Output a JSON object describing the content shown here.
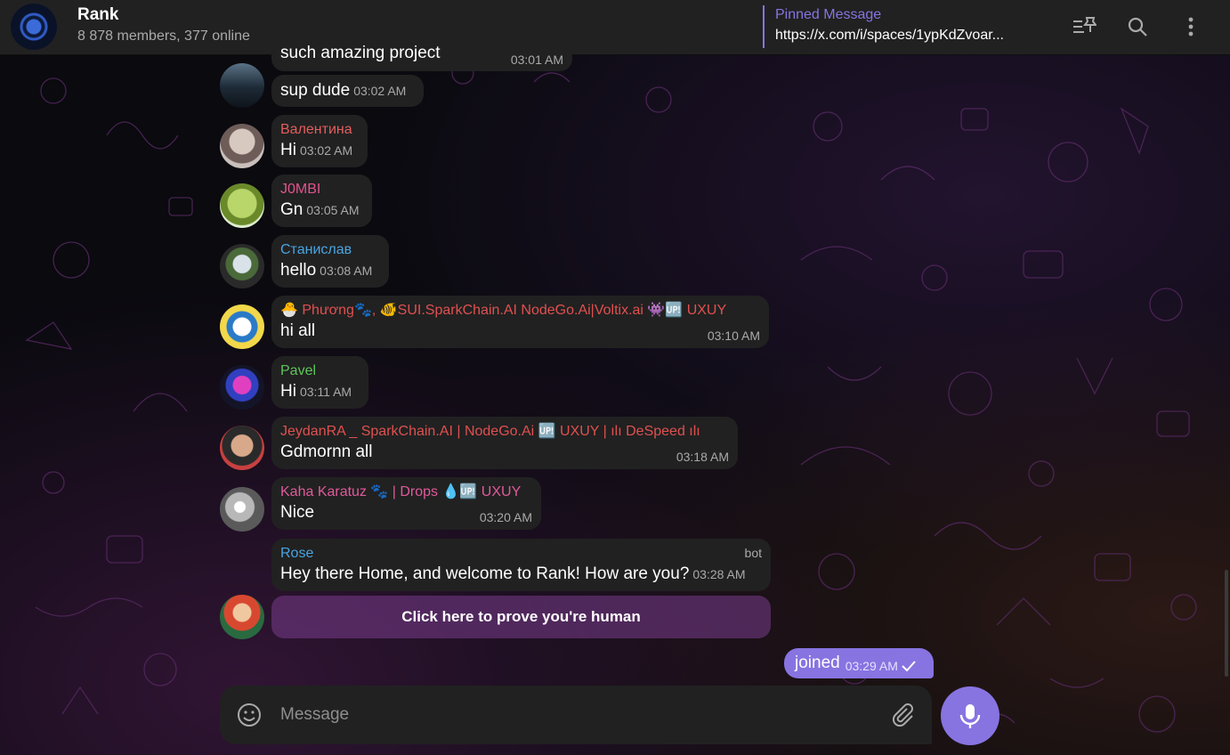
{
  "header": {
    "title": "Rank",
    "subtitle": "8 878 members, 377 online",
    "pinned_label": "Pinned Message",
    "pinned_text": "https://x.com/i/spaces/1ypKdZvoar..."
  },
  "messages": [
    {
      "sender": "",
      "text": "such amazing project",
      "time": "03:01 AM"
    },
    {
      "sender": "",
      "text": "sup dude",
      "time": "03:02 AM"
    },
    {
      "sender": "Валентина",
      "text": "Hi",
      "time": "03:02 AM",
      "color": "#e45d5d"
    },
    {
      "sender": "J0MBI",
      "text": "Gn",
      "time": "03:05 AM",
      "color": "#e0548c"
    },
    {
      "sender": "Станислав",
      "text": "hello",
      "time": "03:08 AM",
      "color": "#4aa4e0"
    },
    {
      "sender": "🐣 Phương🐾, 🐠SUI.SparkChain.AI NodeGo.Ai|Voltix.ai 👾🆙 UXUY",
      "text": "hi all",
      "time": "03:10 AM",
      "color": "#e05050"
    },
    {
      "sender": "Pavel",
      "text": "Hi",
      "time": "03:11 AM",
      "color": "#5fc45a"
    },
    {
      "sender": "JeydanRA _ SparkChain.AI | NodeGo.Ai 🆙 UXUY | ılı DeSpeed ılı",
      "text": "Gdmornn all",
      "time": "03:18 AM",
      "color": "#e05050"
    },
    {
      "sender": "Kaha Karatuz 🐾 | Drops 💧🆙 UXUY",
      "text": "Nice",
      "time": "03:20 AM",
      "color": "#e05a9a"
    },
    {
      "sender": "Rose",
      "badge": "bot",
      "text": "Hey there Home, and welcome to Rank! How are you?",
      "time": "03:28 AM",
      "color": "#4aa4e0"
    }
  ],
  "inline_button": "Click here to prove you're human",
  "own_message": {
    "text": "joined",
    "time": "03:29 AM"
  },
  "composer": {
    "placeholder": "Message"
  },
  "colors": {
    "accent": "#8774e1",
    "bubble": "#212121",
    "header": "#212121"
  }
}
